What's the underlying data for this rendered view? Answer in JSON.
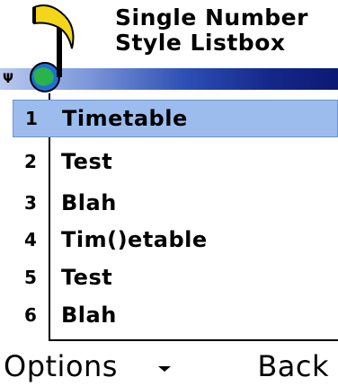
{
  "title": {
    "line1": "Single Number",
    "line2": "Style Listbox"
  },
  "status": {
    "signal_icon": "antenna-icon"
  },
  "list": {
    "items": [
      {
        "number": "1",
        "label": "Timetable",
        "selected": true
      },
      {
        "number": "2",
        "label": "Test",
        "selected": false
      },
      {
        "number": "3",
        "label": "Blah",
        "selected": false
      },
      {
        "number": "4",
        "label": "Tim()etable",
        "selected": false
      },
      {
        "number": "5",
        "label": "Test",
        "selected": false
      },
      {
        "number": "6",
        "label": "Blah",
        "selected": false
      }
    ]
  },
  "softkeys": {
    "left": "Options",
    "right": "Back",
    "scroll_icon": "scroll-down-arrow-icon"
  },
  "colors": {
    "selection": "#9cbcee",
    "status_strip_dark": "#0c1a73"
  }
}
